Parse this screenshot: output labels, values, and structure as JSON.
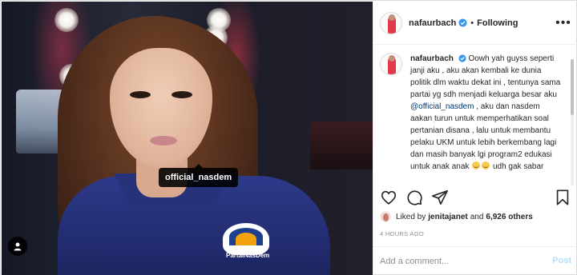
{
  "post": {
    "media": {
      "tag_label": "official_nasdem",
      "shirt_badge_text": "PartaiNasDem"
    },
    "header": {
      "username": "nafaurbach",
      "separator": "•",
      "follow_state": "Following",
      "more_label": "•••"
    },
    "caption": {
      "username": "nafaurbach",
      "text_part1": "Oowh yah guyss seperti janji aku , aku akan kembali ke dunia politik dlm waktu dekat ini , tentunya sama partai yg sdh menjadi keluarga besar aku ",
      "mention": "@official_nasdem",
      "text_part2": " , aku dan nasdem aakan turun untuk memperhatikan soal pertanian disana , lalu untuk membantu pelaku UKM untuk lebih berkembang lagi dan masih banyak lgi program2 edukasi untuk anak anak ",
      "text_part3": " udh gak sabar"
    },
    "likes": {
      "prefix": "Liked by",
      "liker": "jenitajanet",
      "conjunction": "and",
      "count": "6,926 others"
    },
    "timestamp": "4 HOURS AGO",
    "comment": {
      "placeholder": "Add a comment...",
      "post_label": "Post"
    },
    "icons": {
      "like": "heart-icon",
      "comment": "comment-icon",
      "share": "share-icon",
      "save": "bookmark-icon",
      "verified": "verified-badge-icon",
      "user_tags": "user-tags-icon"
    },
    "colors": {
      "verified": "#3897f0",
      "mention": "#00376b",
      "post_disabled": "#b2dffc",
      "muted": "#8e8e8e"
    }
  }
}
